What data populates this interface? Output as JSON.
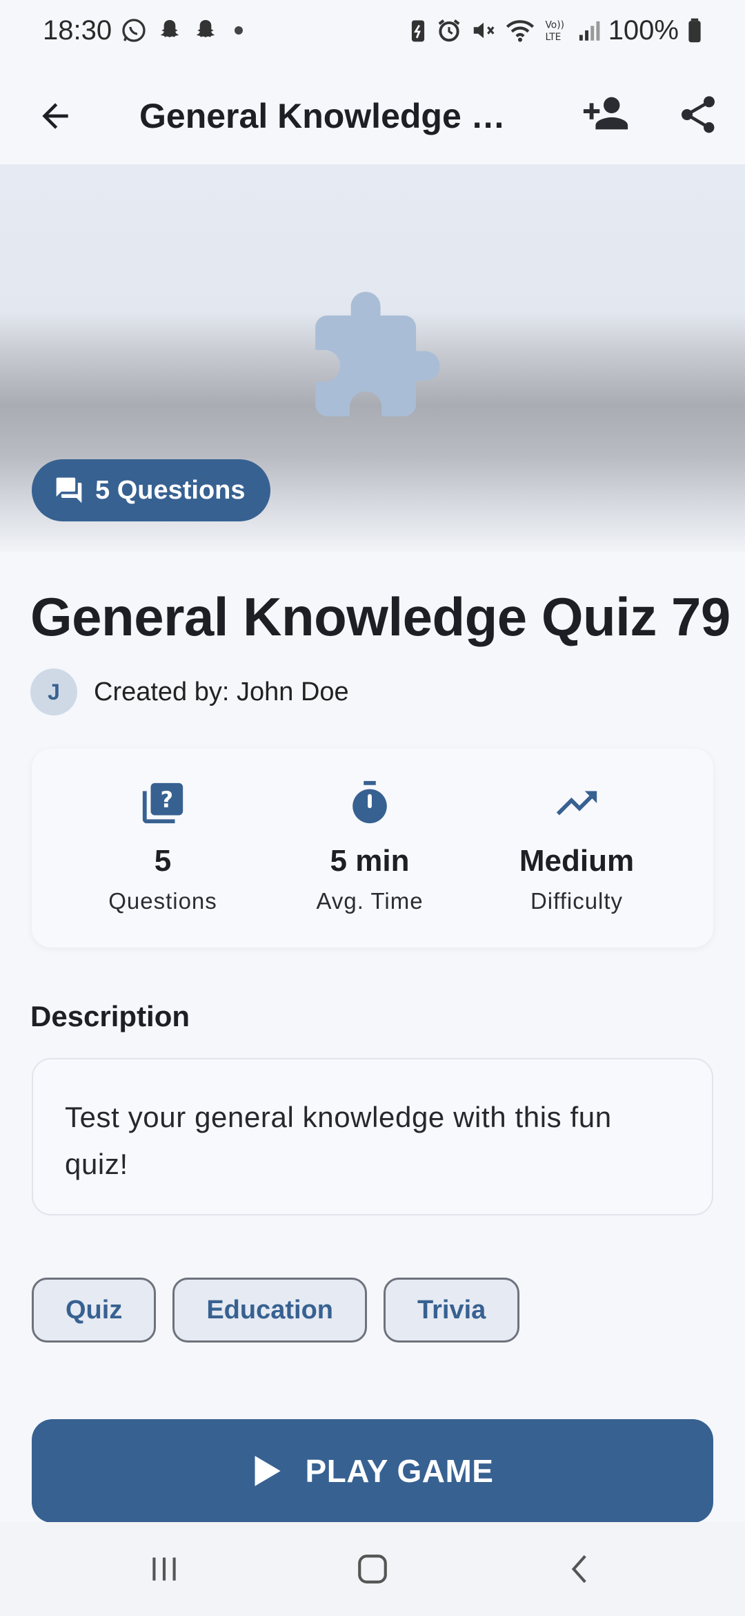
{
  "status_bar": {
    "time": "18:30",
    "battery": "100%",
    "icons": [
      "whatsapp-icon",
      "snapchat-icon",
      "snapchat-icon",
      "notification-dot",
      "battery-saver-icon",
      "alarm-icon",
      "mute-icon",
      "wifi-icon",
      "volte-icon",
      "signal-icon",
      "battery-icon"
    ]
  },
  "app_bar": {
    "title": "General Knowledge Quiz 79",
    "icons": [
      "back-arrow-icon",
      "person-add-icon",
      "share-icon"
    ]
  },
  "hero": {
    "icon": "puzzle-icon",
    "chip_label": "5 Questions",
    "chip_icon": "forum-icon"
  },
  "quiz": {
    "title": "General Knowledge Quiz 79",
    "creator_initial": "J",
    "creator_text": "Created by: John Doe"
  },
  "stats": [
    {
      "icon": "quiz-icon",
      "value": "5",
      "label": "Questions"
    },
    {
      "icon": "timer-icon",
      "value": "5 min",
      "label": "Avg. Time"
    },
    {
      "icon": "trending-up-icon",
      "value": "Medium",
      "label": "Difficulty"
    }
  ],
  "description": {
    "heading": "Description",
    "text": "Test your general knowledge with this fun quiz!"
  },
  "tags": [
    "Quiz",
    "Education",
    "Trivia"
  ],
  "play_button": {
    "label": "PLAY GAME",
    "icon": "play-icon"
  },
  "nav_bar": {
    "icons": [
      "recents-icon",
      "home-icon",
      "back-icon"
    ]
  },
  "colors": {
    "accent": "#376191",
    "background": "#f5f7fb",
    "icon_light": "#a9bdd6"
  }
}
